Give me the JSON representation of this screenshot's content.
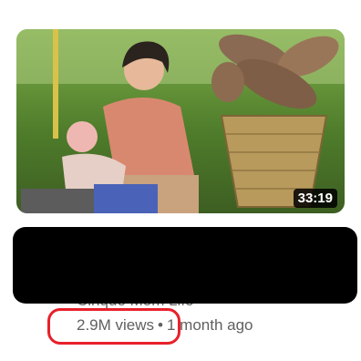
{
  "video": {
    "duration": "33:19",
    "channel": "Cinque Mom Life",
    "views": "2.9M views",
    "separator": "•",
    "age": "1 month ago"
  },
  "colors": {
    "meta_text": "#606060",
    "highlight": "#e8202a",
    "redaction": "#000000"
  }
}
